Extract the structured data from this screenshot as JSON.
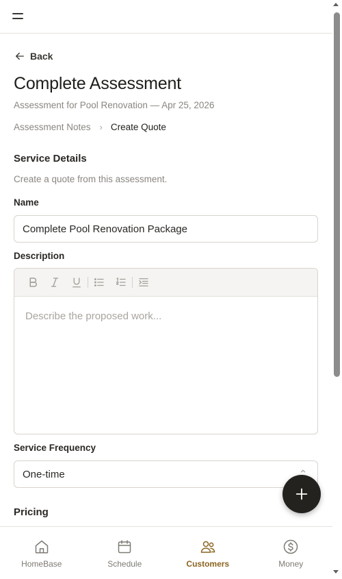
{
  "header": {
    "menu_icon": "hamburger-menu-icon"
  },
  "back": {
    "label": "Back",
    "icon": "arrow-left-icon"
  },
  "page": {
    "title": "Complete Assessment",
    "subtitle": "Assessment for Pool Renovation — Apr 25, 2026"
  },
  "breadcrumb": {
    "parent": "Assessment Notes",
    "separator": "›",
    "current": "Create Quote"
  },
  "service_details": {
    "title": "Service Details",
    "description": "Create a quote from this assessment."
  },
  "form": {
    "name_label": "Name",
    "name_value": "Complete Pool Renovation Package",
    "description_label": "Description",
    "description_placeholder": "Describe the proposed work...",
    "frequency_label": "Service Frequency",
    "frequency_value": "One-time"
  },
  "editor_toolbar": [
    "bold-icon",
    "italic-icon",
    "underline-icon",
    "bullet-list-icon",
    "numbered-list-icon",
    "indent-icon"
  ],
  "pricing": {
    "title": "Pricing"
  },
  "fab": {
    "icon": "plus-icon"
  },
  "bottom_nav": [
    {
      "label": "HomeBase",
      "icon": "home-icon",
      "active": false
    },
    {
      "label": "Schedule",
      "icon": "calendar-icon",
      "active": false
    },
    {
      "label": "Customers",
      "icon": "users-icon",
      "active": true
    },
    {
      "label": "Money",
      "icon": "dollar-circle-icon",
      "active": false
    }
  ],
  "colors": {
    "accent": "#8a6420",
    "fab": "#24221e",
    "muted_text": "#8a8680",
    "border": "#d8d4ce"
  }
}
